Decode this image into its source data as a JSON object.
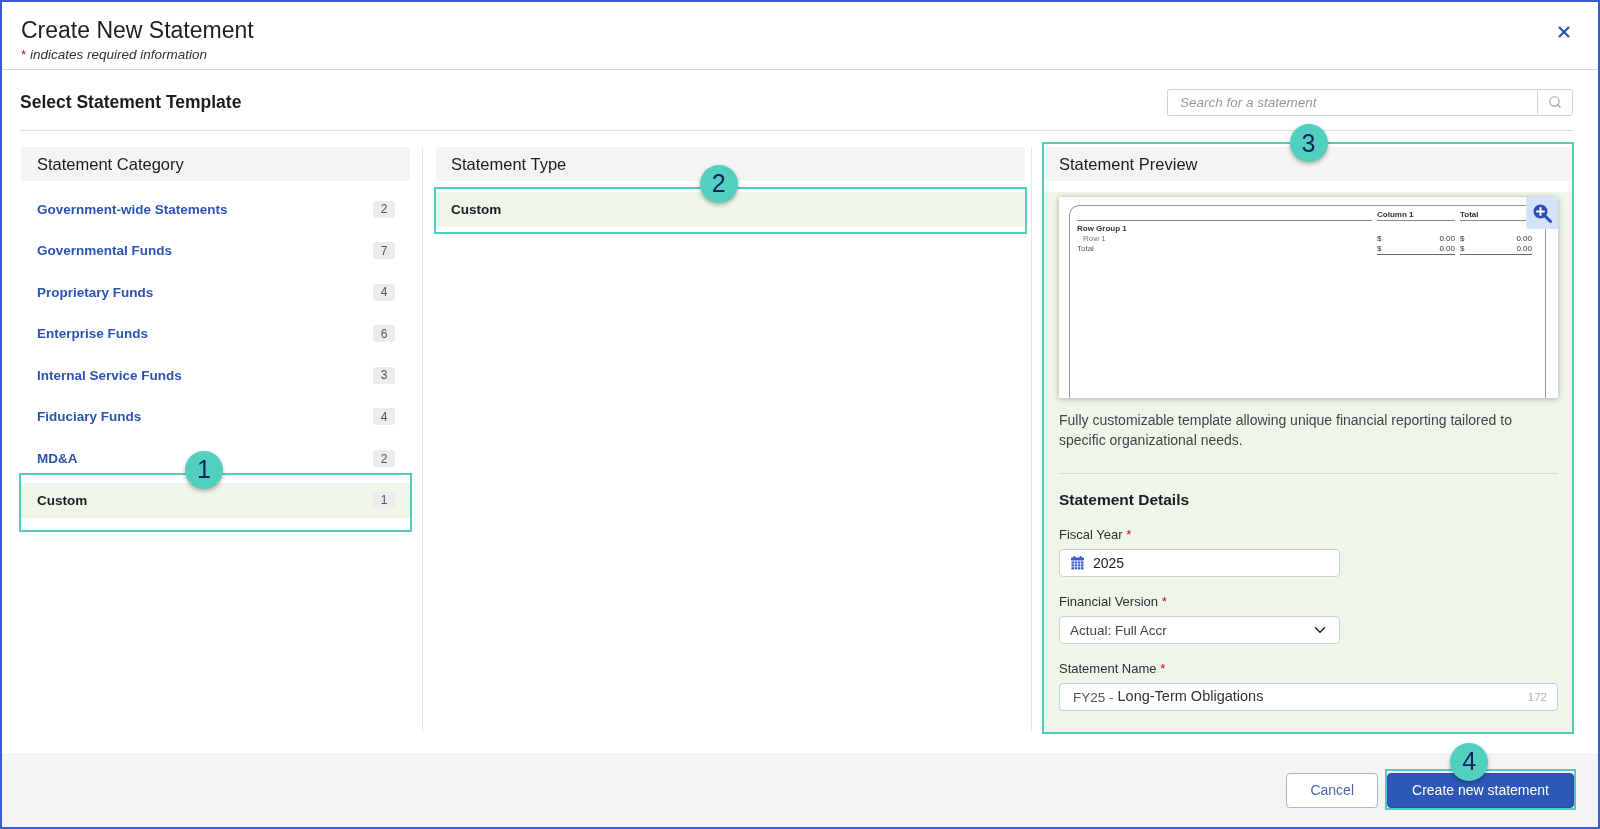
{
  "dialog": {
    "title": "Create New Statement",
    "required_note": {
      "marker": "*",
      "text": "indicates required information"
    }
  },
  "template_section": {
    "title": "Select Statement Template",
    "search": {
      "placeholder": "Search for a statement"
    }
  },
  "categories": {
    "heading": "Statement Category",
    "items": [
      {
        "label": "Government-wide Statements",
        "count": "2",
        "selected": false
      },
      {
        "label": "Governmental Funds",
        "count": "7",
        "selected": false
      },
      {
        "label": "Proprietary Funds",
        "count": "4",
        "selected": false
      },
      {
        "label": "Enterprise Funds",
        "count": "6",
        "selected": false
      },
      {
        "label": "Internal Service Funds",
        "count": "3",
        "selected": false
      },
      {
        "label": "Fiduciary Funds",
        "count": "4",
        "selected": false
      },
      {
        "label": "MD&A",
        "count": "2",
        "selected": false
      },
      {
        "label": "Custom",
        "count": "1",
        "selected": true,
        "callout": "1"
      }
    ]
  },
  "types": {
    "heading": "Statement Type",
    "items": [
      {
        "label": "Custom",
        "selected": true,
        "callout": "2"
      }
    ]
  },
  "preview": {
    "heading": "Statement Preview",
    "callout": "3",
    "document": {
      "columns": [
        "Column 1",
        "Total"
      ],
      "rows": [
        {
          "kind": "group",
          "label": "Row Group 1"
        },
        {
          "kind": "line",
          "label": "Row 1",
          "cells": [
            {
              "symbol": "$",
              "amount": "0.00"
            },
            {
              "symbol": "$",
              "amount": "0.00"
            }
          ]
        },
        {
          "kind": "total",
          "label": "Total",
          "cells": [
            {
              "symbol": "$",
              "amount": "0.00"
            },
            {
              "symbol": "$",
              "amount": "0.00"
            }
          ]
        }
      ]
    },
    "description": "Fully customizable template allowing unique financial reporting tailored to specific organizational needs."
  },
  "details": {
    "heading": "Statement Details",
    "fields": [
      {
        "kind": "date",
        "label": "Fiscal Year",
        "required_marker": "*",
        "value": "2025"
      },
      {
        "kind": "select",
        "label": "Financial Version",
        "required_marker": "*",
        "value": "Actual: Full Accr"
      },
      {
        "kind": "text",
        "label": "Statement Name",
        "required_marker": "*",
        "prefix": "FY25 -",
        "value": "Long-Term Obligations",
        "counter": "172"
      }
    ]
  },
  "footer": {
    "buttons": [
      {
        "kind": "secondary",
        "label": "Cancel"
      },
      {
        "kind": "primary",
        "label": "Create new statement",
        "callout": "4"
      }
    ]
  }
}
